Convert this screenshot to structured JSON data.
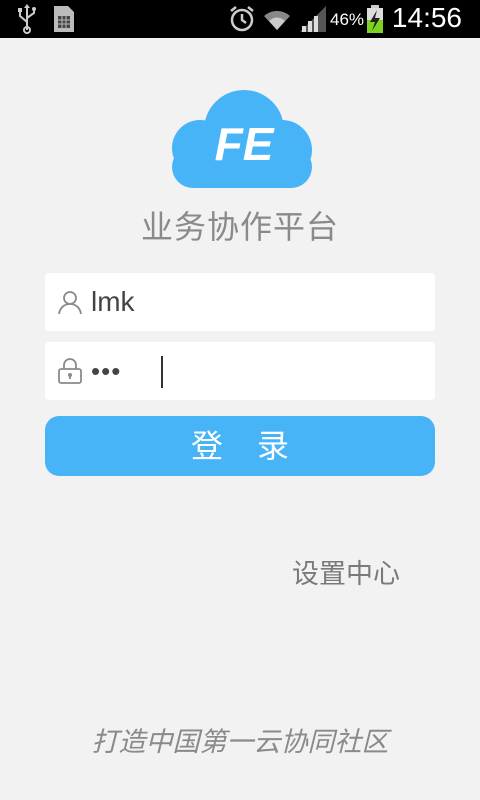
{
  "status_bar": {
    "battery_percent": "46%",
    "time": "14:56",
    "icons": [
      "usb-icon",
      "sim-card-icon",
      "alarm-icon",
      "wifi-icon",
      "signal-icon",
      "battery-charging-icon"
    ]
  },
  "app": {
    "logo_text": "FE",
    "title": "业务协作平台"
  },
  "login_form": {
    "username_value": "lmk",
    "password_value": "•••",
    "username_icon": "user-icon",
    "password_icon": "lock-icon",
    "login_label": "登录"
  },
  "settings_label": "设置中心",
  "slogan": "打造中国第一云协同社区",
  "colors": {
    "background": "#f2f2f2",
    "accent": "#47b4f8",
    "text_gray": "#8a8a8a",
    "status_bar": "#000000"
  }
}
